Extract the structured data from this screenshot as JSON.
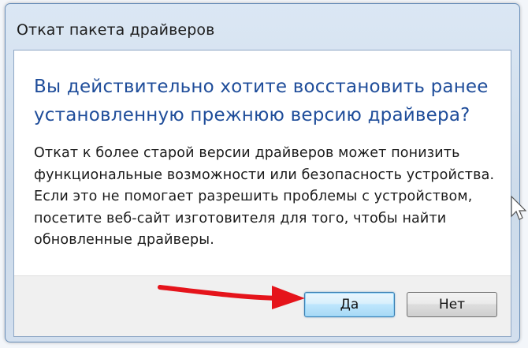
{
  "window": {
    "title": "Откат пакета драйверов"
  },
  "dialog": {
    "main_instruction": "Вы действительно хотите восстановить ранее установленную прежнюю версию драйвера?",
    "content": "Откат к более старой версии драйверов может понизить функциональные возможности или безопасность устройства. Если это не помогает разрешить проблемы с устройством, посетите веб-сайт изготовителя для того, чтобы найти обновленные драйверы."
  },
  "buttons": {
    "yes_label": "Да",
    "no_label": "Нет"
  },
  "annotation": {
    "arrow_color": "#e5141b"
  }
}
